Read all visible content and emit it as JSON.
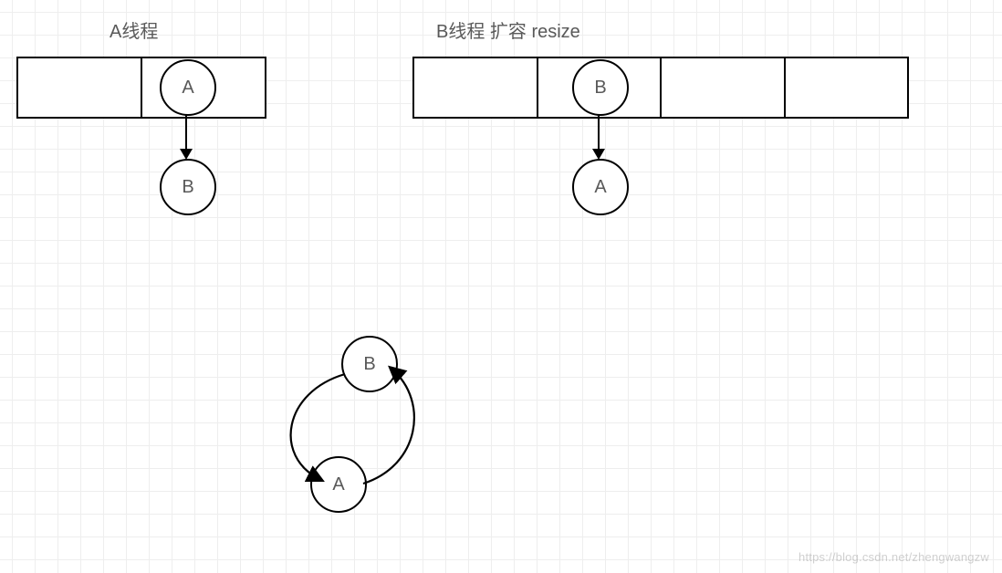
{
  "colors": {
    "stroke": "#000000",
    "text": "#595959",
    "grid": "#eeeeee",
    "bg": "#ffffff"
  },
  "left": {
    "title": "A线程",
    "array_cells": 2,
    "slot_node": "A",
    "chain_node": "B"
  },
  "right": {
    "title": "B线程 扩容 resize",
    "array_cells": 4,
    "slot_node": "B",
    "chain_node": "A"
  },
  "cycle": {
    "top_node": "B",
    "bottom_node": "A"
  },
  "watermark": "https://blog.csdn.net/zhengwangzw"
}
